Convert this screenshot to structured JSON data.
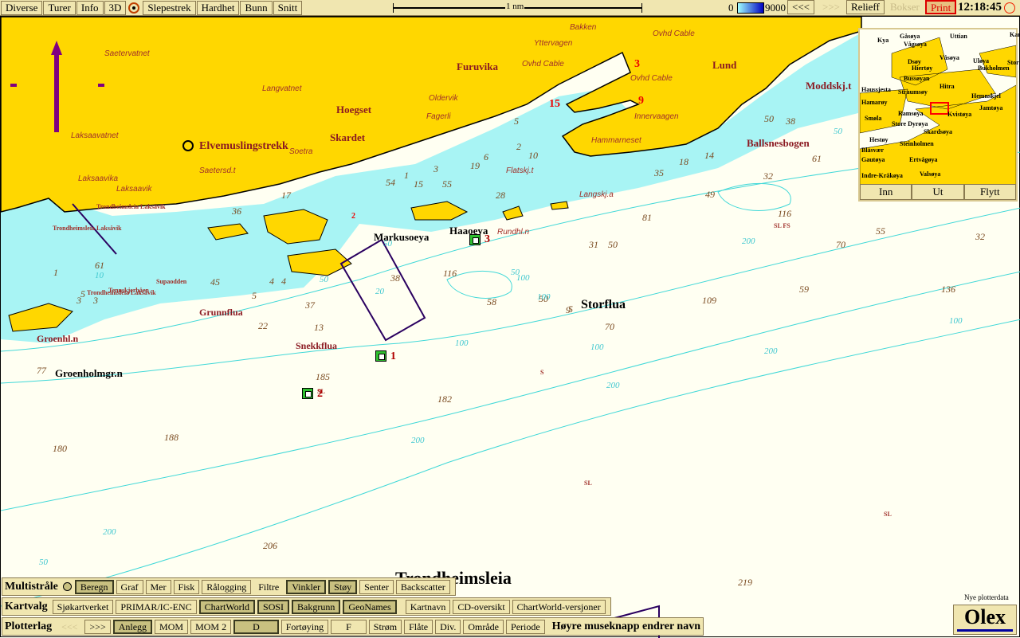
{
  "topbar": {
    "buttons": [
      "Diverse",
      "Turer",
      "Info",
      "3D"
    ],
    "buttons2": [
      "Slepestrek",
      "Hardhet",
      "Bunn",
      "Snitt"
    ],
    "scale": "1 nm",
    "depth_min": "0",
    "depth_max": "9000",
    "prev": "<<<",
    "next": ">>>",
    "relief": "Relieff",
    "bokser": "Bokser",
    "print": "Print",
    "clock": "12:18:45"
  },
  "map": {
    "places": [
      "Furuvika",
      "Lund",
      "Hoegset",
      "Skardet",
      "Moddskj.t",
      "Ballsnesbogen",
      "Elvemuslingstrekk",
      "Grunnflua",
      "Snekkflua",
      "Groenhl.n"
    ],
    "islands": [
      "Markusoeya",
      "Haaoeya",
      "Storflua",
      "Groenholmgr.n",
      "Trondheimsleia"
    ],
    "names": [
      "Saetervatnet",
      "Langvatnet",
      "Laksaavatnet",
      "Laksaavika",
      "Laksaavik",
      "Saetersd.t",
      "Soetra",
      "Bakken",
      "Yttervagen",
      "Ovhd Cable",
      "Ovhd Cable",
      "Ovhd Cable",
      "Oldervik",
      "Fagerli",
      "Innervaagen",
      "Hammarneset",
      "Flatskj.t",
      "Langskj.a",
      "Rundhl.n"
    ],
    "tiny": [
      "Trondheimsleia Laksåvik",
      "Trondheimsleia Laksåvik",
      "Tennskjerbåen",
      "Supaodden",
      "Trondheimsleia Laksåvik",
      "SL",
      "SL FS",
      "SL",
      "SL",
      "S"
    ],
    "soundings": [
      "36",
      "17",
      "54",
      "1",
      "15",
      "55",
      "3",
      "19",
      "28",
      "6",
      "2",
      "10",
      "5",
      "18",
      "14",
      "35",
      "49",
      "81",
      "50",
      "38",
      "61",
      "32",
      "116",
      "70",
      "55",
      "32",
      "31",
      "50",
      "58",
      "116",
      "38",
      "50",
      "109",
      "59",
      "136",
      "70",
      "9",
      "37",
      "22",
      "13",
      "45",
      "5",
      "4",
      "4",
      "61",
      "1",
      "3",
      "185",
      "182",
      "188",
      "180",
      "206",
      "219",
      "77",
      "5",
      "3",
      "5"
    ],
    "contours": [
      "10",
      "20",
      "50",
      "50",
      "50",
      "100",
      "100",
      "100",
      "100",
      "200",
      "200",
      "200",
      "200",
      "200",
      "50",
      "50",
      "100"
    ],
    "markers": [
      "1",
      "2",
      "3"
    ],
    "red_numbers": [
      "15",
      "3",
      "9",
      "2"
    ],
    "colors": {
      "land": "#ffd700",
      "shallow": "#a8f4f4",
      "sea": "#fffff2",
      "contour": "#40d8d8",
      "route": "#2a0060",
      "north_arrow": "#800080"
    }
  },
  "minimap": {
    "labels": [
      "Gåsøya",
      "Kya",
      "Uttian",
      "Vågsøya",
      "Karlsøy",
      "Dsøy",
      "Våsøya",
      "Uløya",
      "Stor",
      "Hiertøy",
      "Bukholmen",
      "Bussøyan",
      "Hitra",
      "Haussjesta",
      "Straumsøy",
      "Hemnskjel",
      "Hamarøy",
      "Jamtøya",
      "Ramsøya",
      "Kvistøya",
      "Smøla",
      "Store Dyrøya",
      "Skardsøya",
      "Hestøy",
      "Steinholmen",
      "Blåsvær",
      "Gautøya",
      "Ertvågøya",
      "Indre-Kråkøya",
      "Valsøya"
    ],
    "inn": "Inn",
    "ut": "Ut",
    "flytt": "Flytt"
  },
  "multistrale": {
    "title": "Multistråle",
    "buttons": [
      "Beregn",
      "Graf",
      "Mer",
      "Fisk",
      "Rålogging",
      "Filtre",
      "Vinkler",
      "Støy",
      "Senter",
      "Backscatter"
    ]
  },
  "kartvalg": {
    "title": "Kartvalg",
    "buttons": [
      "Sjøkartverket",
      "PRIMAR/IC-ENC",
      "ChartWorld",
      "SOSI",
      "Bakgrunn",
      "GeoNames",
      "Kartnavn",
      "CD-oversikt",
      "ChartWorld-versjoner"
    ]
  },
  "plotterlag": {
    "title": "Plotterlag",
    "buttons": [
      "<<<",
      ">>>",
      "Anlegg",
      "MOM",
      "MOM 2",
      "D",
      "Fortøying",
      "F",
      "Strøm",
      "Flåte",
      "Div.",
      "Område",
      "Periode"
    ],
    "hint": "Høyre museknapp endrer navn"
  },
  "status": {
    "new_data": "Nye plotterdata",
    "logo": "Olex"
  }
}
